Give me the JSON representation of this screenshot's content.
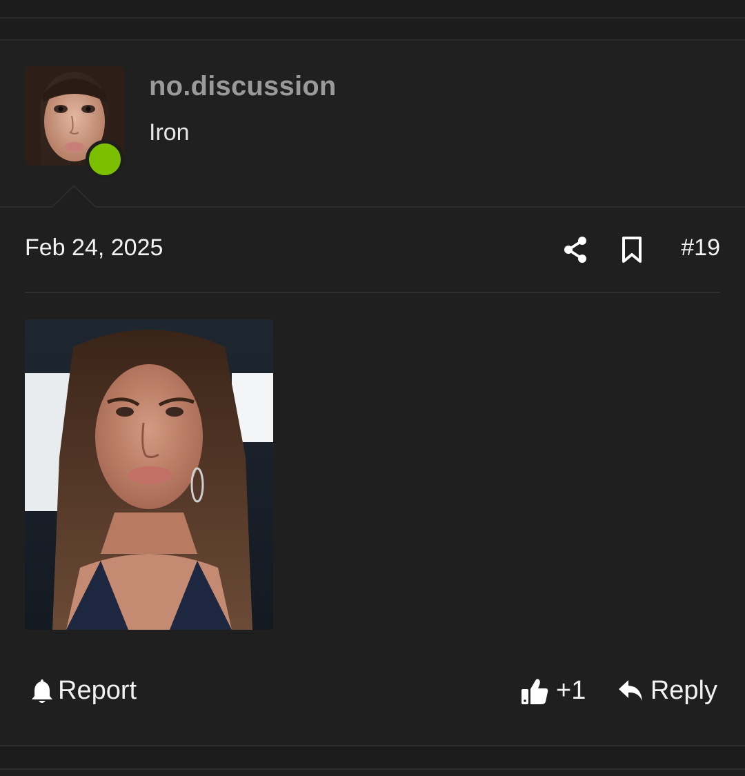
{
  "post": {
    "author": {
      "username": "no.discussion",
      "title": "Iron",
      "online": true,
      "online_color": "#7cbf00"
    },
    "date": "Feb 24, 2025",
    "number": "#19",
    "icons": [
      "share-icon",
      "bookmark-icon"
    ]
  },
  "actions": {
    "report_label": "Report",
    "like_label": "+1",
    "reply_label": "Reply"
  },
  "colors": {
    "background": "#1f1f1f",
    "username": "#9a9a9a",
    "text": "#f2f2f2"
  }
}
